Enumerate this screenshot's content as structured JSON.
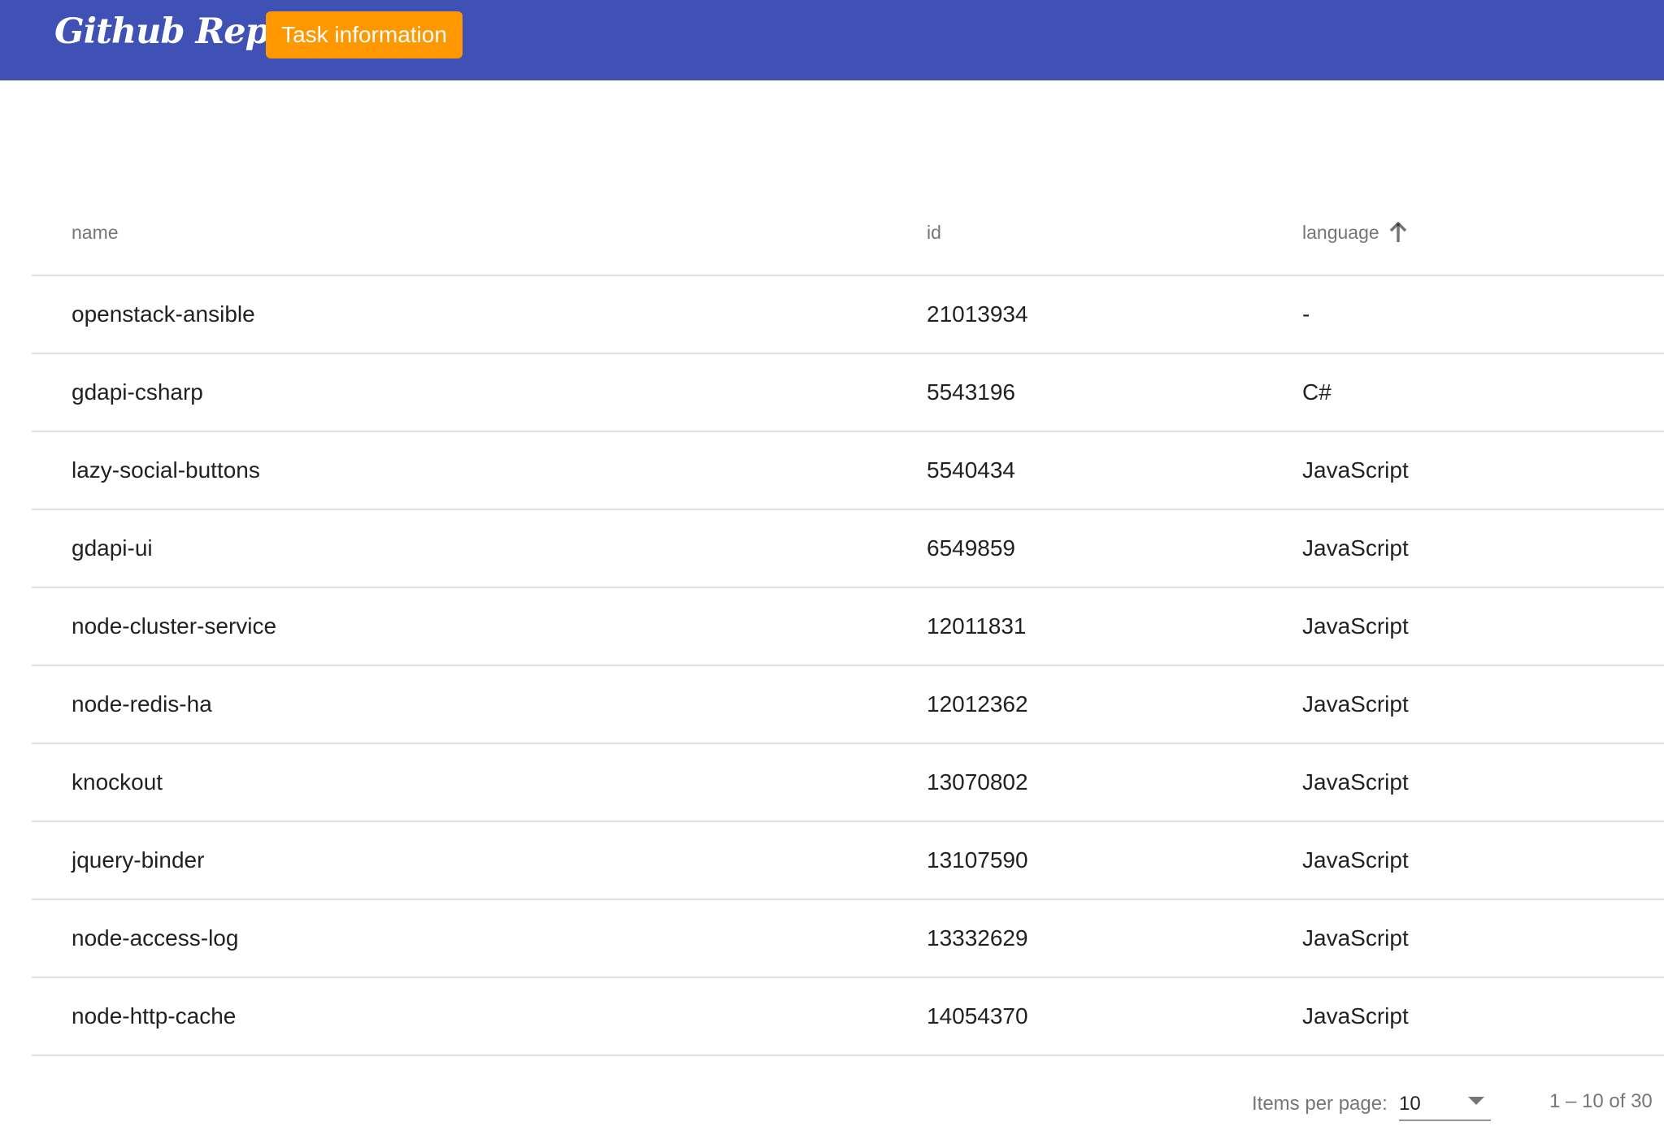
{
  "toolbar": {
    "brand": "Github Repos",
    "task_button_label": "Task information",
    "color": "#3f51b5",
    "button_color": "#ff9800"
  },
  "table": {
    "columns": {
      "name": "name",
      "id": "id",
      "language": "language"
    },
    "sort": {
      "column": "language",
      "direction": "ascending",
      "icon": "arrow-up-icon"
    },
    "rows": [
      {
        "name": "openstack-ansible",
        "id": "21013934",
        "language": "-"
      },
      {
        "name": "gdapi-csharp",
        "id": "5543196",
        "language": "C#"
      },
      {
        "name": "lazy-social-buttons",
        "id": "5540434",
        "language": "JavaScript"
      },
      {
        "name": "gdapi-ui",
        "id": "6549859",
        "language": "JavaScript"
      },
      {
        "name": "node-cluster-service",
        "id": "12011831",
        "language": "JavaScript"
      },
      {
        "name": "node-redis-ha",
        "id": "12012362",
        "language": "JavaScript"
      },
      {
        "name": "knockout",
        "id": "13070802",
        "language": "JavaScript"
      },
      {
        "name": "jquery-binder",
        "id": "13107590",
        "language": "JavaScript"
      },
      {
        "name": "node-access-log",
        "id": "13332629",
        "language": "JavaScript"
      },
      {
        "name": "node-http-cache",
        "id": "14054370",
        "language": "JavaScript"
      }
    ]
  },
  "paginator": {
    "items_per_page_label": "Items per page:",
    "items_per_page_value": "10",
    "range_label": "1 – 10 of 30"
  }
}
